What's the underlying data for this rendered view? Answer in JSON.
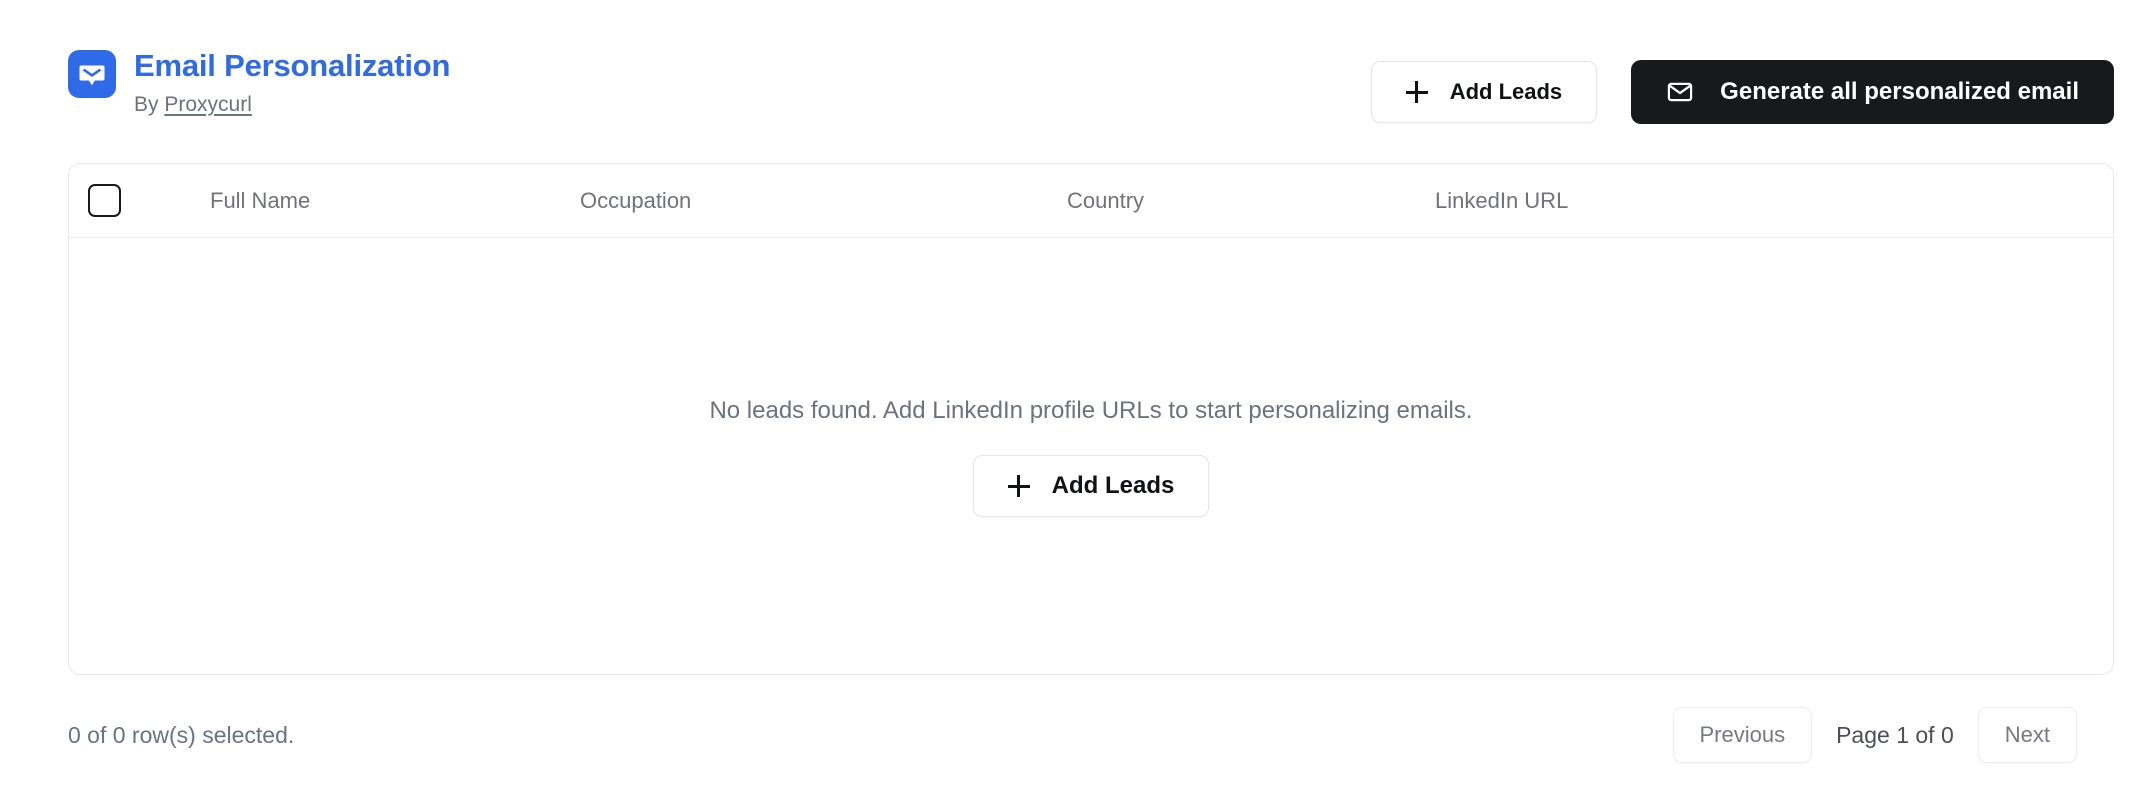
{
  "header": {
    "logo_icon": "email-open-envelope-icon",
    "logo_bg_color": "#2f6ae8",
    "title": "Email Personalization",
    "title_color": "#2f6ae8",
    "byline_prefix": "By",
    "byline_link": "Proxycurl",
    "actions": {
      "add_leads_label": "Add Leads",
      "add_leads_icon": "plus-icon",
      "generate_label": "Generate all personalized email",
      "generate_icon": "mail-icon",
      "generate_bg_color": "#18191b"
    }
  },
  "table": {
    "select_all_checked": false,
    "columns": [
      {
        "key": "full_name",
        "label": "Full Name"
      },
      {
        "key": "occupation",
        "label": "Occupation"
      },
      {
        "key": "country",
        "label": "Country"
      },
      {
        "key": "linkedin_url",
        "label": "LinkedIn URL"
      }
    ],
    "rows": [],
    "empty_state": {
      "message": "No leads found. Add LinkedIn profile URLs to start personalizing emails.",
      "add_leads_label": "Add Leads",
      "add_leads_icon": "plus-icon"
    }
  },
  "footer": {
    "rows_selected": "0 of 0 row(s) selected.",
    "previous_label": "Previous",
    "page_indicator": "Page 1 of 0",
    "next_label": "Next"
  }
}
